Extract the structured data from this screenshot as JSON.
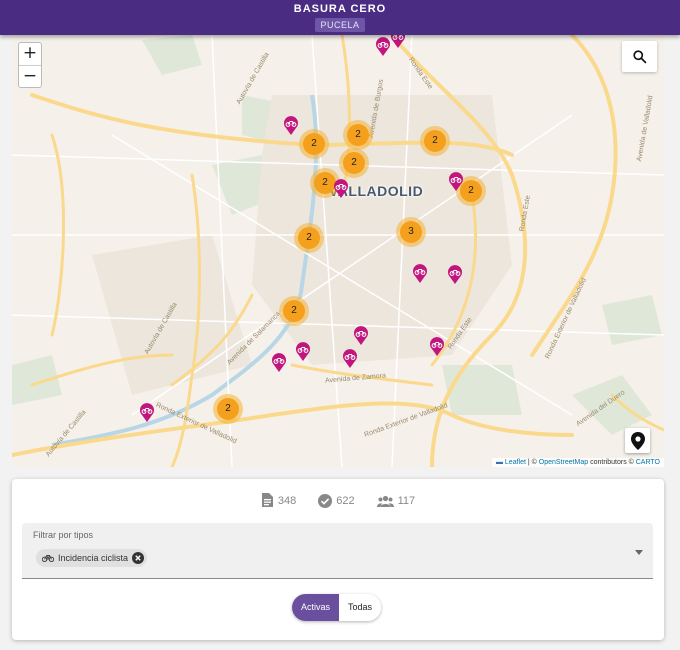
{
  "header": {
    "title": "BASURA CERO",
    "city": "PUCELA"
  },
  "map": {
    "zoom_in": "+",
    "zoom_out": "−",
    "city_label": "VALLADOLID",
    "road_labels": [
      "Autovía de Castilla",
      "Avenida de Burgos",
      "Ronda Este",
      "Ronda Este",
      "Ronda Este",
      "Avenida de Salamanca",
      "Avenida de Zamora",
      "Ronda Exterior de Valladolid",
      "Ronda Exterior de Valladolid",
      "Autovía de Castilla",
      "Avenida del Duero",
      "Ronda Exterior de Valladolid",
      "Avenida de Valladolid",
      "Autovía de Castilla"
    ],
    "clusters": [
      "2",
      "2",
      "2",
      "2",
      "2",
      "2",
      "2",
      "3",
      "2",
      "2"
    ],
    "attribution": {
      "leaflet": "Leaflet",
      "sep": " | © ",
      "osm": "OpenStreetMap",
      "contrib": " contributors © ",
      "carto": "CARTO"
    },
    "icons": {
      "search": "search-icon",
      "location": "location-pin-icon",
      "pin": "bicycle-pin-icon"
    },
    "colors": {
      "pin": "#c2157d",
      "cluster": "#f4a01c"
    }
  },
  "stats": {
    "documents": "348",
    "resolved": "622",
    "users": "117"
  },
  "filter": {
    "label": "Filtrar por tipos",
    "chip": "Incidencia ciclista"
  },
  "toggle": {
    "active": "Activas",
    "all": "Todas"
  },
  "colors": {
    "appbar": "#4a2d82",
    "accent": "#6a4f9e"
  }
}
